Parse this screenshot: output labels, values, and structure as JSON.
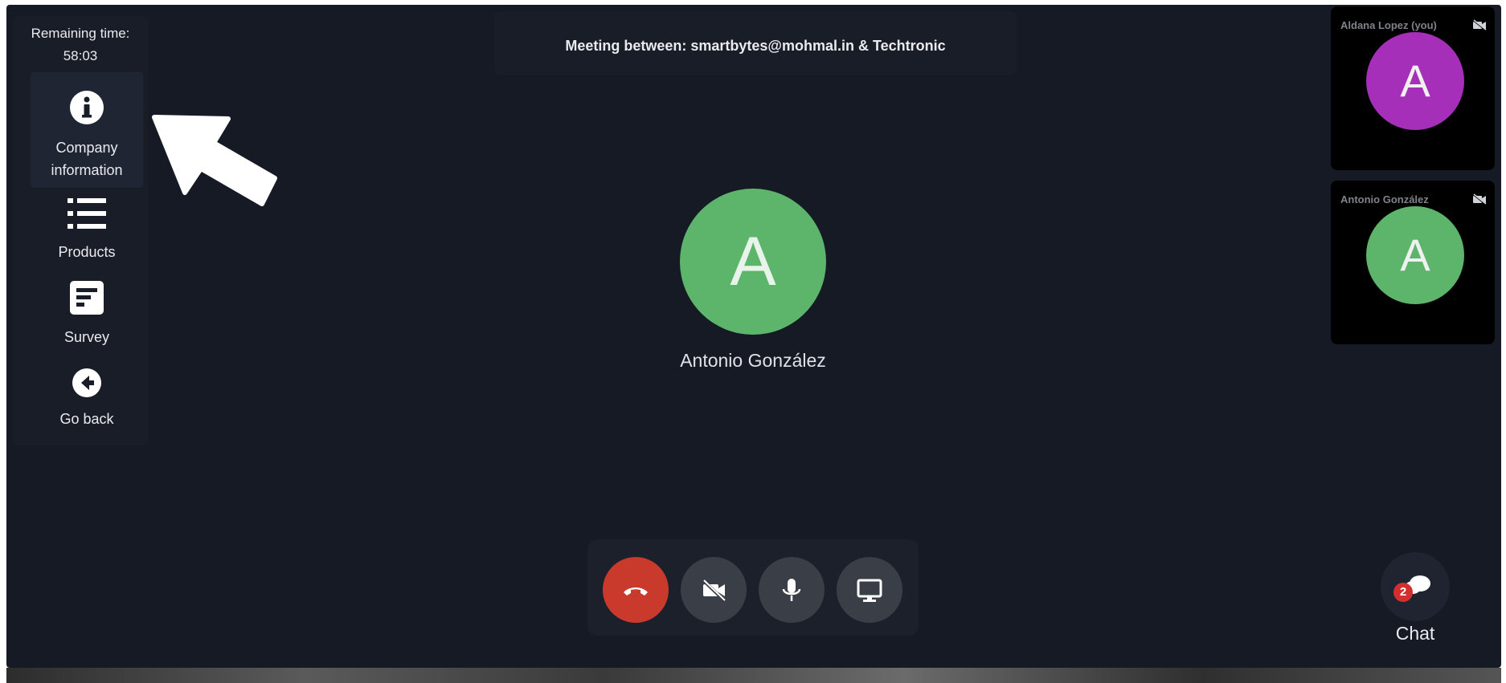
{
  "sidebar": {
    "timer_label": "Remaining time:",
    "timer_value": "58:03",
    "items": [
      {
        "label_line1": "Company",
        "label_line2": "information",
        "icon": "info-icon",
        "active": true
      },
      {
        "label": "Products",
        "icon": "list-icon"
      },
      {
        "label": "Survey",
        "icon": "document-icon"
      },
      {
        "label": "Go back",
        "icon": "arrow-left-circle-icon"
      }
    ]
  },
  "header": {
    "title": "Meeting between: smartbytes@mohmal.in & Techtronic"
  },
  "main": {
    "avatar_initial": "A",
    "participant_name": "Antonio González",
    "avatar_color": "#5cb56b"
  },
  "tiles": [
    {
      "name": "Aldana Lopez (you)",
      "initial": "A",
      "color": "#a52fb8",
      "camera": "camera-off-icon"
    },
    {
      "name": "Antonio González",
      "initial": "A",
      "color": "#5cb56b",
      "camera": "camera-off-icon"
    }
  ],
  "controls": [
    {
      "icon": "hangup-icon",
      "color": "#c93a2c"
    },
    {
      "icon": "camera-off-icon"
    },
    {
      "icon": "microphone-icon"
    },
    {
      "icon": "screen-share-icon"
    }
  ],
  "chat": {
    "label": "Chat",
    "badge": "2",
    "icon": "chat-bubbles-icon"
  }
}
